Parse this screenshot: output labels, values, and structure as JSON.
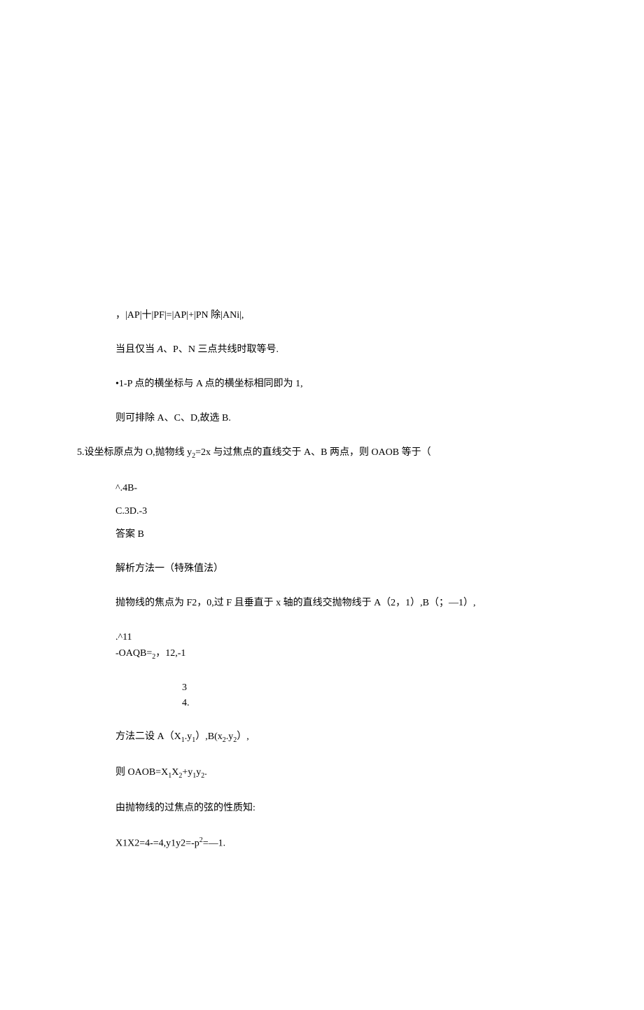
{
  "line1": "，|AP|十|PF|=|AP|+|PN 除|ANi|,",
  "line2_pre": "当且仅当 ",
  "line2_A": "A",
  "line2_post": "、P、N 三点共线时取等号.",
  "line3": "•1-P 点的横坐标与 A 点的横坐标相同即为 1,",
  "line4": "则可排除 A、C、D,故选 B.",
  "q5_pre": "5.设坐标原点为 O,抛物线 y",
  "q5_sub1": "2",
  "q5_eq": "=",
  "q5_rhs": "2x 与过焦点的直线交于 A、B 两点，则 OAOB 等于（",
  "optAB": "^.4B-",
  "optCD": "C.3D.-3",
  "ans": "答案 B",
  "method1": "解析方法一（特殊值法）",
  "parabola_focus": "抛物线的焦点为 F2，0,过 F 且垂直于 x 轴的直线交抛物线于 A（2，1）,B（；—1）,",
  "oa_line1": ".^11",
  "oa_line2_pre": "-OAQB=",
  "oa_line2_sub": "2",
  "oa_line2_post": "，12,-1",
  "num_3": "3",
  "num_4": "4.",
  "method2_pre": "方法二设 A（X",
  "method2_s1": "1",
  "method2_mid1": ".y",
  "method2_s2": "1",
  "method2_mid2": "）,B(x",
  "method2_s3": "2",
  "method2_mid3": ".y",
  "method2_s4": "2",
  "method2_end": "）,",
  "then_pre": "则 OAOB=X",
  "then_s1": "1",
  "then_mid1": "X",
  "then_s2": "2",
  "then_plus": "+y",
  "then_s3": "1",
  "then_mid2": "y",
  "then_s4": "2",
  "then_end": ".",
  "chord": "由抛物线的过焦点的弦的性质知:",
  "final_pre": "X1X2=4-=4,y1y2=-p",
  "final_sup": "2",
  "final_post": "=—1."
}
